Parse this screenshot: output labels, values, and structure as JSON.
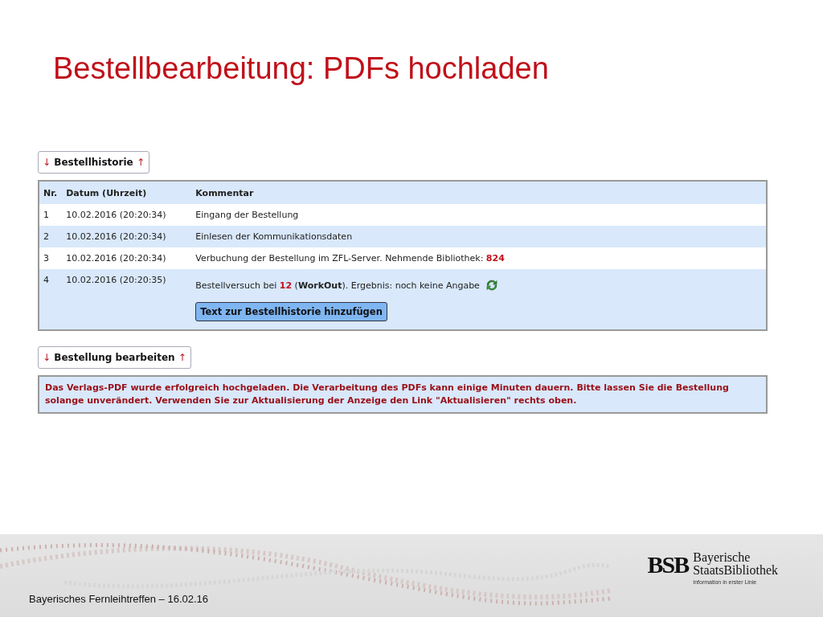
{
  "slide": {
    "title": "Bestellbearbeitung: PDFs hochladen"
  },
  "history_toggle": {
    "arrow_down": "↓",
    "label": "Bestellhistorie",
    "arrow_up": "↑"
  },
  "table": {
    "columns": [
      "Nr.",
      "Datum (Uhrzeit)",
      "Kommentar"
    ],
    "rows": [
      {
        "nr": "1",
        "date": "10.02.2016 (20:20:34)",
        "comment": [
          {
            "text": "Eingang der Bestellung",
            "kind": "text"
          }
        ]
      },
      {
        "nr": "2",
        "date": "10.02.2016 (20:20:34)",
        "comment": [
          {
            "text": "Einlesen der Kommunikationsdaten",
            "kind": "text"
          }
        ]
      },
      {
        "nr": "3",
        "date": "10.02.2016 (20:20:34)",
        "comment": [
          {
            "text": "Verbuchung der Bestellung im ZFL-Server. Nehmende Bibliothek: ",
            "kind": "text"
          },
          {
            "text": "824",
            "kind": "number"
          }
        ]
      },
      {
        "nr": "4",
        "date": "10.02.2016 (20:20:35)",
        "comment": [
          {
            "text": "Bestellversuch bei ",
            "kind": "text"
          },
          {
            "text": "12",
            "kind": "number"
          },
          {
            "text": " (",
            "kind": "text"
          },
          {
            "text": "WorkOut",
            "kind": "name"
          },
          {
            "text": "). Ergebnis: noch keine Angabe",
            "kind": "text"
          }
        ],
        "refresh_icon": true,
        "button": "Text zur Bestellhistorie hinzufügen"
      }
    ]
  },
  "edit_toggle": {
    "arrow_down": "↓",
    "label": "Bestellung bearbeiten",
    "arrow_up": "↑"
  },
  "message": "Das Verlags-PDF wurde erfolgreich hochgeladen. Die Verarbeitung des PDFs kann einige Minuten dauern. Bitte lassen Sie die Bestellung solange unverändert. Verwenden Sie zur Aktualisierung der Anzeige den Link \"Aktualisieren\" rechts oben.",
  "footer": {
    "text": "Bayerisches Fernleihtreffen – 16.02.16",
    "logo_mark": "BSB",
    "logo_name_1": "Bayerische",
    "logo_name_2": "StaatsBibliothek",
    "logo_tagline": "Information in erster Linie"
  }
}
